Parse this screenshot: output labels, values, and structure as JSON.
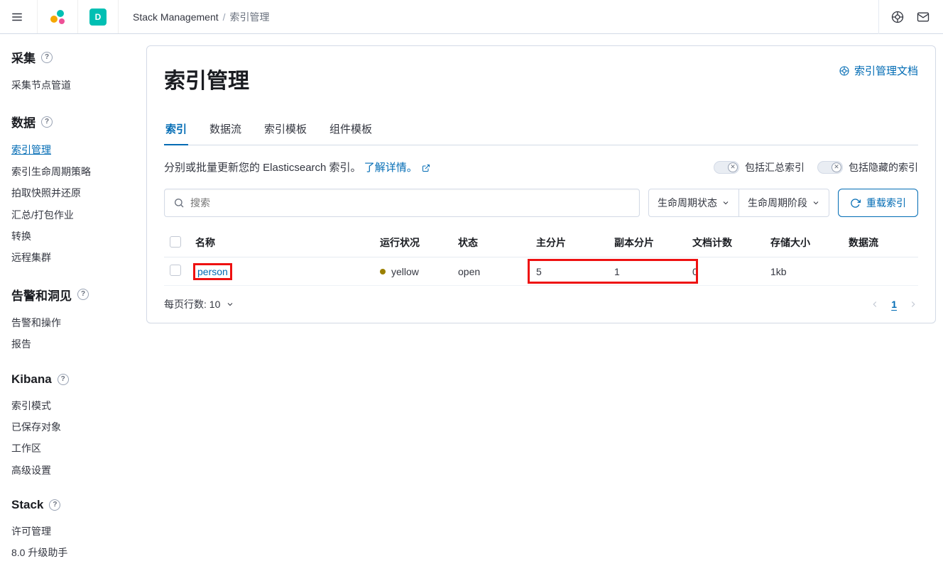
{
  "header": {
    "avatar_initial": "D",
    "breadcrumbs": [
      "Stack Management",
      "索引管理"
    ]
  },
  "sidebar": {
    "sections": [
      {
        "title": "采集",
        "items": [
          "采集节点管道"
        ]
      },
      {
        "title": "数据",
        "items": [
          "索引管理",
          "索引生命周期策略",
          "拍取快照并还原",
          "汇总/打包作业",
          "转换",
          "远程集群"
        ],
        "active": 0
      },
      {
        "title": "告警和洞见",
        "items": [
          "告警和操作",
          "报告"
        ]
      },
      {
        "title": "Kibana",
        "items": [
          "索引模式",
          "已保存对象",
          "工作区",
          "高级设置"
        ]
      },
      {
        "title": "Stack",
        "items": [
          "许可管理",
          "8.0 升级助手"
        ]
      }
    ]
  },
  "main": {
    "title": "索引管理",
    "docs_link": "索引管理文档",
    "tabs": [
      "索引",
      "数据流",
      "索引模板",
      "组件模板"
    ],
    "active_tab": 0,
    "desc_prefix": "分别或批量更新您的 Elasticsearch 索引。",
    "desc_link": "了解详情。",
    "toggles": {
      "rollup": "包括汇总索引",
      "hidden": "包括隐藏的索引"
    },
    "toolbar": {
      "search_placeholder": "搜索",
      "filter_status": "生命周期状态",
      "filter_phase": "生命周期阶段",
      "reload": "重载索引"
    },
    "table": {
      "columns": [
        "名称",
        "运行状况",
        "状态",
        "主分片",
        "副本分片",
        "文档计数",
        "存储大小",
        "数据流"
      ],
      "rows": [
        {
          "name": "person",
          "health": "yellow",
          "status": "open",
          "primaries": "5",
          "replicas": "1",
          "docs": "0",
          "size": "1kb",
          "stream": ""
        }
      ]
    },
    "footer": {
      "rows_label": "每页行数: 10",
      "page": "1"
    }
  }
}
